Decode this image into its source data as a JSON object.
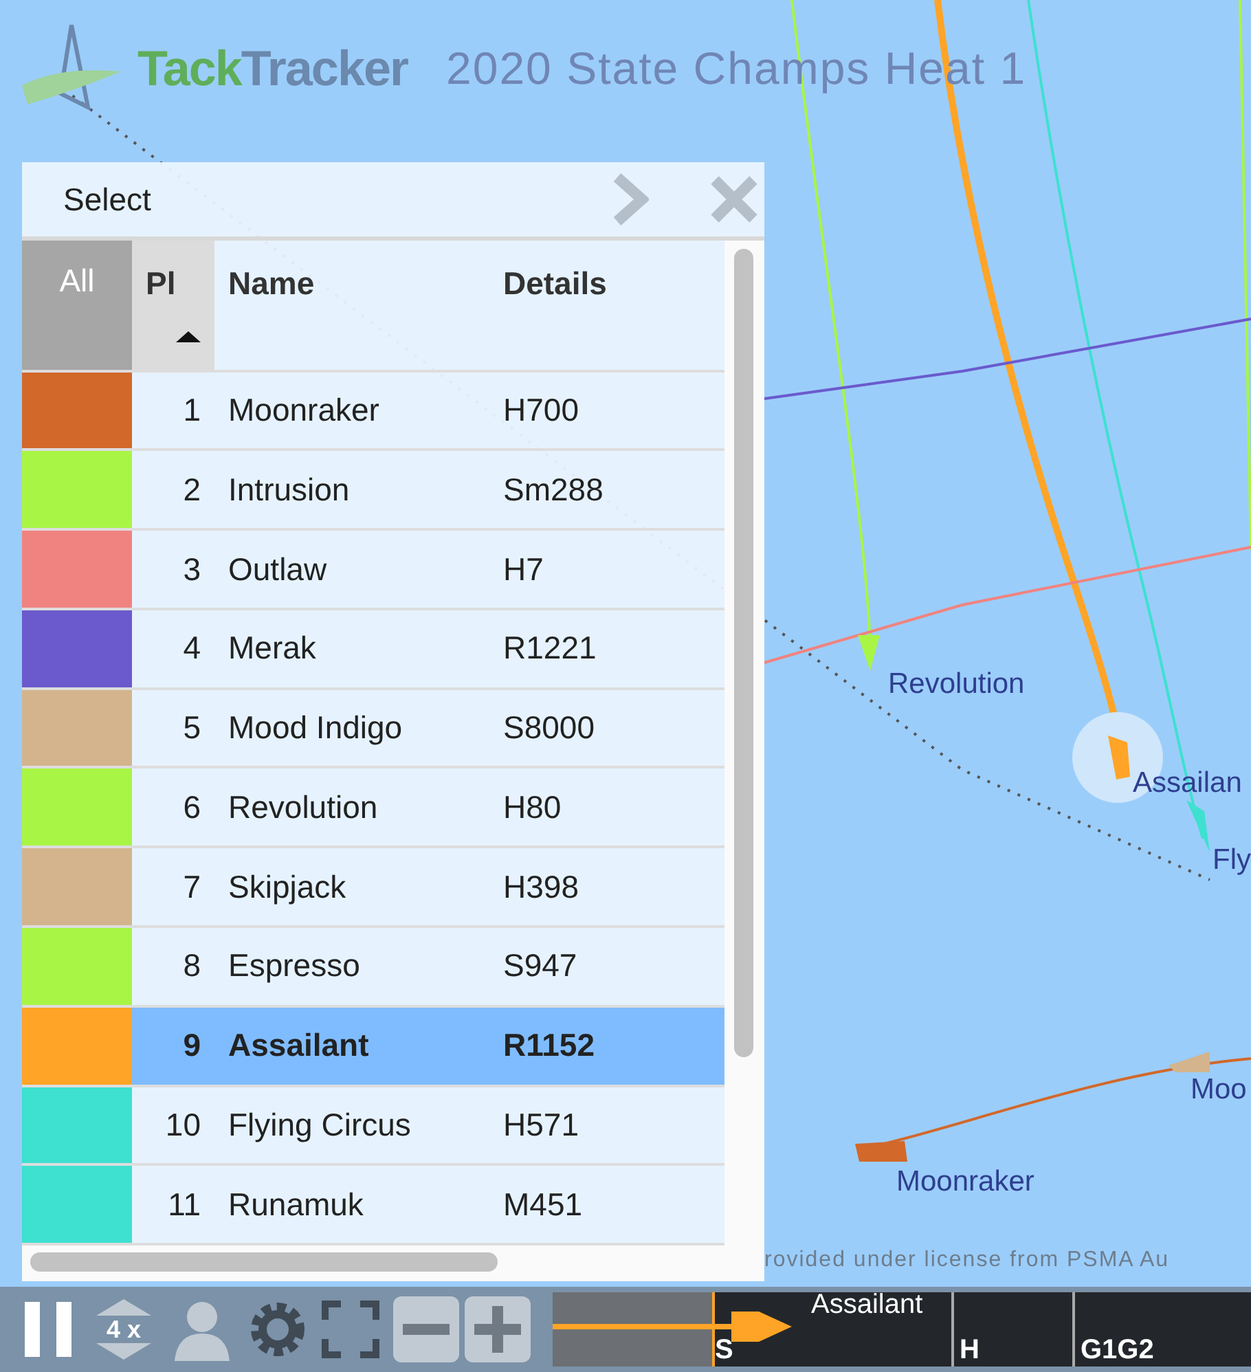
{
  "header": {
    "logo": {
      "accent": "Tack",
      "main": "Tracker"
    },
    "title": "2020 State Champs Heat 1"
  },
  "map": {
    "labels": [
      "Revolution",
      "Assailan",
      "Fly",
      "Moo",
      "Moonraker"
    ],
    "attribution": "rovided under license from PSMA Au"
  },
  "panel": {
    "title": "Select",
    "columns": [
      "All",
      "Pl",
      "Name",
      "Details"
    ],
    "rows": [
      {
        "color": "#d2682a",
        "pl": "1",
        "name": "Moonraker",
        "details": "H700",
        "selected": false
      },
      {
        "color": "#a8f545",
        "pl": "2",
        "name": "Intrusion",
        "details": "Sm288",
        "selected": false
      },
      {
        "color": "#f0837f",
        "pl": "3",
        "name": "Outlaw",
        "details": "H7",
        "selected": false
      },
      {
        "color": "#6a5acd",
        "pl": "4",
        "name": "Merak",
        "details": "R1221",
        "selected": false
      },
      {
        "color": "#d3b48c",
        "pl": "5",
        "name": "Mood Indigo",
        "details": "S8000",
        "selected": false
      },
      {
        "color": "#a8f545",
        "pl": "6",
        "name": "Revolution",
        "details": "H80",
        "selected": false
      },
      {
        "color": "#d3b48c",
        "pl": "7",
        "name": "Skipjack",
        "details": "H398",
        "selected": false
      },
      {
        "color": "#a8f545",
        "pl": "8",
        "name": "Espresso",
        "details": "S947",
        "selected": false
      },
      {
        "color": "#ffa426",
        "pl": "9",
        "name": "Assailant",
        "details": "R1152",
        "selected": true
      },
      {
        "color": "#3ee0d0",
        "pl": "10",
        "name": "Flying Circus",
        "details": "H571",
        "selected": false
      },
      {
        "color": "#3ee0d0",
        "pl": "11",
        "name": "Runamuk",
        "details": "M451",
        "selected": false
      }
    ]
  },
  "toolbar": {
    "speed": "4 x",
    "timeline": {
      "boat": "Assailant",
      "marks": [
        "S",
        "H",
        "G1G2"
      ]
    }
  }
}
